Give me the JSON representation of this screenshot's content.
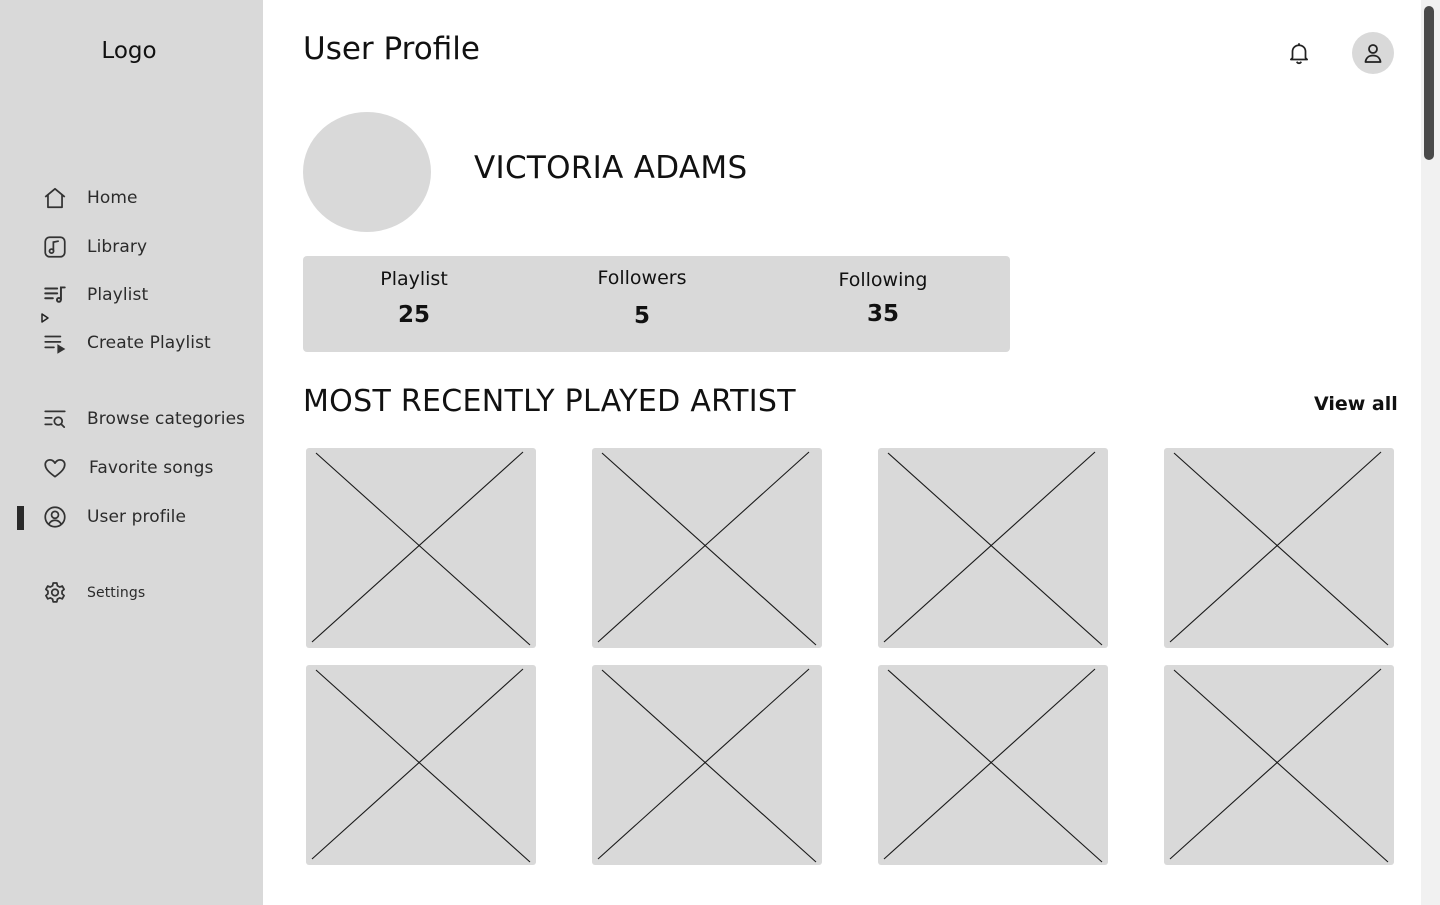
{
  "sidebar": {
    "logo": "Logo",
    "items": [
      {
        "id": "home",
        "label": "Home",
        "icon": "home-icon"
      },
      {
        "id": "library",
        "label": "Library",
        "icon": "music-library-icon"
      },
      {
        "id": "playlist",
        "label": "Playlist",
        "icon": "playlist-icon"
      },
      {
        "id": "create-playlist",
        "label": "Create Playlist",
        "icon": "create-playlist-icon"
      },
      {
        "id": "browse-categories",
        "label": "Browse categories",
        "icon": "browse-search-icon"
      },
      {
        "id": "favorite-songs",
        "label": "Favorite songs",
        "icon": "heart-icon"
      },
      {
        "id": "user-profile",
        "label": "User profile",
        "icon": "user-circle-icon",
        "active": true
      },
      {
        "id": "settings",
        "label": "Settings",
        "icon": "gear-icon"
      }
    ]
  },
  "header": {
    "title": "User Profile",
    "bell_icon": "bell-icon",
    "avatar_icon": "user-icon"
  },
  "profile": {
    "name": "VICTORIA ADAMS",
    "stats": [
      {
        "label": "Playlist",
        "value": "25"
      },
      {
        "label": "Followers",
        "value": "5"
      },
      {
        "label": "Following",
        "value": "35"
      }
    ]
  },
  "recent_artists": {
    "title": "MOST RECENTLY PLAYED ARTIST",
    "view_all": "View all",
    "cards": 8,
    "placeholder_icon": "image-placeholder-icon"
  },
  "colors": {
    "sidebar_bg": "#d9d9d9",
    "placeholder_bg": "#d9d9d9",
    "text": "#111111",
    "active_indicator": "#2a2a2a"
  }
}
